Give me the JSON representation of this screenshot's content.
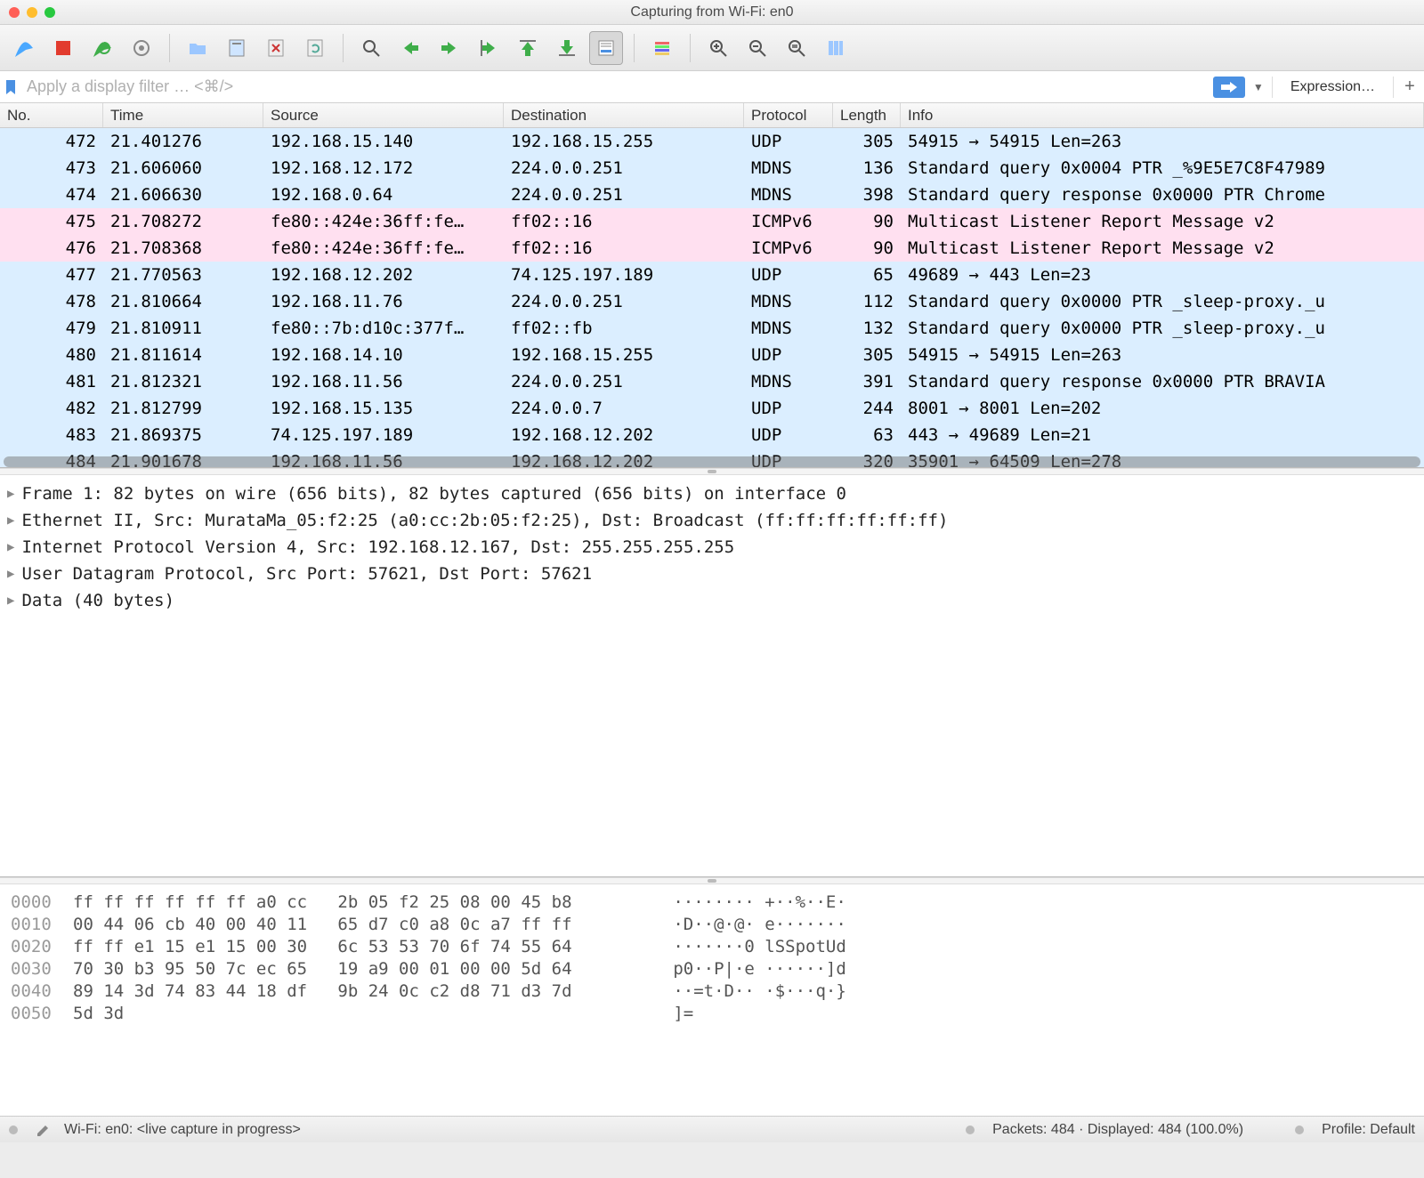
{
  "window": {
    "title": "Capturing from Wi-Fi: en0"
  },
  "filter": {
    "placeholder": "Apply a display filter … <⌘/>",
    "expression_label": "Expression…"
  },
  "columns": {
    "no": "No.",
    "time": "Time",
    "src": "Source",
    "dst": "Destination",
    "proto": "Protocol",
    "len": "Length",
    "info": "Info"
  },
  "packets": [
    {
      "no": "472",
      "time": "21.401276",
      "src": "192.168.15.140",
      "dst": "192.168.15.255",
      "proto": "UDP",
      "len": "305",
      "info": "54915 → 54915 Len=263",
      "cls": "blue"
    },
    {
      "no": "473",
      "time": "21.606060",
      "src": "192.168.12.172",
      "dst": "224.0.0.251",
      "proto": "MDNS",
      "len": "136",
      "info": "Standard query 0x0004 PTR _%9E5E7C8F47989",
      "cls": "blue"
    },
    {
      "no": "474",
      "time": "21.606630",
      "src": "192.168.0.64",
      "dst": "224.0.0.251",
      "proto": "MDNS",
      "len": "398",
      "info": "Standard query response 0x0000 PTR Chrome",
      "cls": "blue"
    },
    {
      "no": "475",
      "time": "21.708272",
      "src": "fe80::424e:36ff:fe…",
      "dst": "ff02::16",
      "proto": "ICMPv6",
      "len": "90",
      "info": "Multicast Listener Report Message v2",
      "cls": "pink"
    },
    {
      "no": "476",
      "time": "21.708368",
      "src": "fe80::424e:36ff:fe…",
      "dst": "ff02::16",
      "proto": "ICMPv6",
      "len": "90",
      "info": "Multicast Listener Report Message v2",
      "cls": "pink"
    },
    {
      "no": "477",
      "time": "21.770563",
      "src": "192.168.12.202",
      "dst": "74.125.197.189",
      "proto": "UDP",
      "len": "65",
      "info": "49689 → 443 Len=23",
      "cls": "blue"
    },
    {
      "no": "478",
      "time": "21.810664",
      "src": "192.168.11.76",
      "dst": "224.0.0.251",
      "proto": "MDNS",
      "len": "112",
      "info": "Standard query 0x0000 PTR _sleep-proxy._u",
      "cls": "blue"
    },
    {
      "no": "479",
      "time": "21.810911",
      "src": "fe80::7b:d10c:377f…",
      "dst": "ff02::fb",
      "proto": "MDNS",
      "len": "132",
      "info": "Standard query 0x0000 PTR _sleep-proxy._u",
      "cls": "blue"
    },
    {
      "no": "480",
      "time": "21.811614",
      "src": "192.168.14.10",
      "dst": "192.168.15.255",
      "proto": "UDP",
      "len": "305",
      "info": "54915 → 54915 Len=263",
      "cls": "blue"
    },
    {
      "no": "481",
      "time": "21.812321",
      "src": "192.168.11.56",
      "dst": "224.0.0.251",
      "proto": "MDNS",
      "len": "391",
      "info": "Standard query response 0x0000 PTR BRAVIA",
      "cls": "blue"
    },
    {
      "no": "482",
      "time": "21.812799",
      "src": "192.168.15.135",
      "dst": "224.0.0.7",
      "proto": "UDP",
      "len": "244",
      "info": "8001 → 8001 Len=202",
      "cls": "blue"
    },
    {
      "no": "483",
      "time": "21.869375",
      "src": "74.125.197.189",
      "dst": "192.168.12.202",
      "proto": "UDP",
      "len": "63",
      "info": "443 → 49689 Len=21",
      "cls": "blue"
    },
    {
      "no": "484",
      "time": "21.901678",
      "src": "192.168.11.56",
      "dst": "192.168.12.202",
      "proto": "UDP",
      "len": "320",
      "info": "35901 → 64509 Len=278",
      "cls": "blue"
    }
  ],
  "details": [
    "Frame 1: 82 bytes on wire (656 bits), 82 bytes captured (656 bits) on interface 0",
    "Ethernet II, Src: MurataMa_05:f2:25 (a0:cc:2b:05:f2:25), Dst: Broadcast (ff:ff:ff:ff:ff:ff)",
    "Internet Protocol Version 4, Src: 192.168.12.167, Dst: 255.255.255.255",
    "User Datagram Protocol, Src Port: 57621, Dst Port: 57621",
    "Data (40 bytes)"
  ],
  "hex": [
    {
      "off": "0000",
      "b": "ff ff ff ff ff ff a0 cc   2b 05 f2 25 08 00 45 b8",
      "a": "········ +··%··E·"
    },
    {
      "off": "0010",
      "b": "00 44 06 cb 40 00 40 11   65 d7 c0 a8 0c a7 ff ff",
      "a": "·D··@·@· e·······"
    },
    {
      "off": "0020",
      "b": "ff ff e1 15 e1 15 00 30   6c 53 53 70 6f 74 55 64",
      "a": "·······0 lSSpotUd"
    },
    {
      "off": "0030",
      "b": "70 30 b3 95 50 7c ec 65   19 a9 00 01 00 00 5d 64",
      "a": "p0··P|·e ······]d"
    },
    {
      "off": "0040",
      "b": "89 14 3d 74 83 44 18 df   9b 24 0c c2 d8 71 d3 7d",
      "a": "··=t·D·· ·$···q·}"
    },
    {
      "off": "0050",
      "b": "5d 3d",
      "a": "]="
    }
  ],
  "status": {
    "iface": "Wi-Fi: en0: <live capture in progress>",
    "packets": "Packets: 484 · Displayed: 484 (100.0%)",
    "profile": "Profile: Default"
  }
}
